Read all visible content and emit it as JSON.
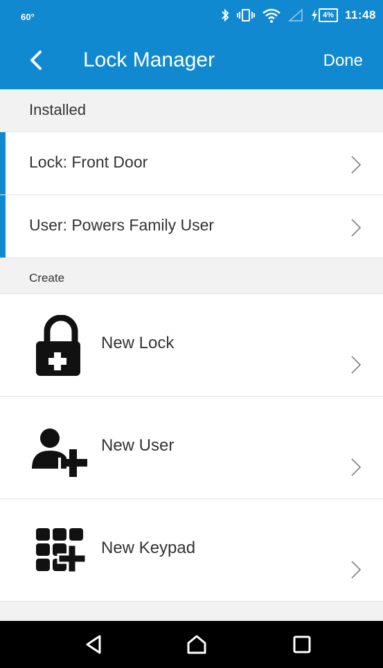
{
  "status_bar": {
    "temperature": "60°",
    "battery_percent": "4%",
    "time": "11:48"
  },
  "app_bar": {
    "title": "Lock Manager",
    "done_label": "Done"
  },
  "sections": {
    "installed_header": "Installed",
    "create_header": "Create"
  },
  "installed_items": [
    {
      "label": "Lock: Front Door"
    },
    {
      "label": "User: Powers Family User"
    }
  ],
  "create_items": [
    {
      "label": "New Lock",
      "icon": "lock-plus-icon"
    },
    {
      "label": "New User",
      "icon": "user-plus-icon"
    },
    {
      "label": "New Keypad",
      "icon": "keypad-plus-icon"
    }
  ],
  "colors": {
    "primary": "#1189d0",
    "accent_bar": "#1189d0",
    "background": "#f2f2f2"
  }
}
